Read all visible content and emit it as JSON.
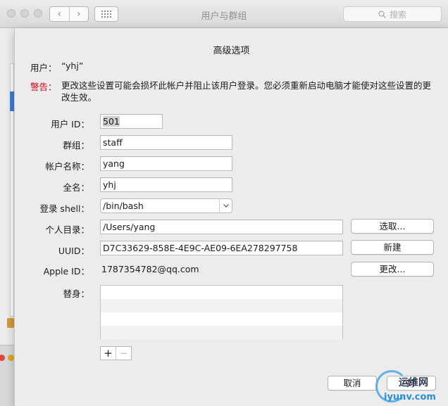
{
  "window": {
    "title": "用户与群组",
    "search_placeholder": "搜索",
    "nav_back": "‹",
    "nav_forward": "›"
  },
  "sheet": {
    "title": "高级选项",
    "user_label": "用户：",
    "user_value": "“yhj”",
    "warning_label": "警告：",
    "warning_text": "更改这些设置可能会损坏此帐户并阻止该用户登录。您必须重新启动电脑才能使对这些设置的更改生效。"
  },
  "form": {
    "user_id": {
      "label": "用户 ID：",
      "value": "501"
    },
    "group": {
      "label": "群组：",
      "value": "staff"
    },
    "account_name": {
      "label": "帐户名称：",
      "value": "yang"
    },
    "full_name": {
      "label": "全名：",
      "value": "yhj"
    },
    "login_shell": {
      "label": "登录 shell：",
      "value": "/bin/bash"
    },
    "home_dir": {
      "label": "个人目录：",
      "value": "/Users/yang",
      "button": "选取..."
    },
    "uuid": {
      "label": "UUID：",
      "value": "D7C33629-858E-4E9C-AE09-6EA278297758",
      "button": "新建"
    },
    "apple_id": {
      "label": "Apple ID：",
      "value": "1787354782@qq.com",
      "button": "更改..."
    },
    "aliases": {
      "label": "替身：",
      "items": []
    }
  },
  "controls": {
    "add": "+",
    "remove": "−",
    "cancel": "取消",
    "ok": "好"
  },
  "watermark": {
    "top": "运维网",
    "bottom": "iyunv.com"
  },
  "colors": {
    "warning": "#d0021b",
    "selection": "#3d7fd6",
    "watermark_blue": "#2b8fd1"
  }
}
